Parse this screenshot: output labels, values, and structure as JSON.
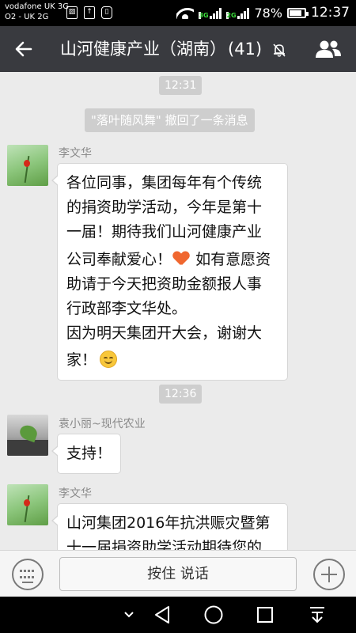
{
  "status_bar": {
    "carrier_line1": "vodafone UK 3G",
    "carrier_line2": "O2 - UK 2G",
    "network1": "3G",
    "network2": "2G",
    "roaming": "R",
    "battery": "78%",
    "time": "12:37",
    "icons": [
      "gallery-icon",
      "sim-icon",
      "vibrate-icon",
      "wifi-icon",
      "signal-icon",
      "battery-icon"
    ]
  },
  "header": {
    "title": "山河健康产业（湖南）",
    "member_count": "(41)",
    "back_icon": "back-arrow-icon",
    "mute_icon": "bell-off-icon",
    "members_icon": "group-members-icon"
  },
  "chat": {
    "timestamp1": "12:31",
    "recall_notice": "\"落叶随风舞\" 撤回了一条消息",
    "msg1": {
      "sender": "李文华",
      "lines": [
        "各位同事，集团每年有个传统",
        "的捐资助学活动，今年是第十",
        "一届！期待我们山河健康产业",
        "公司奉献爱心！",
        "如有意愿资",
        "助请于今天把资助金额报人事",
        "行政部李文华处。",
        "因为明天集团开大会，谢谢大",
        "家！"
      ],
      "emojis": [
        "heart-emoji",
        "smile-emoji"
      ]
    },
    "timestamp2": "12:36",
    "msg2": {
      "sender": "袁小丽~现代农业",
      "text": "支持！"
    },
    "msg3": {
      "sender": "李文华",
      "lines": [
        "山河集团2016年抗洪赈灾暨第",
        "十一届捐资助学活动期待您的"
      ]
    }
  },
  "input_bar": {
    "hold_to_talk": "按住 说话",
    "keyboard_icon": "keyboard-icon",
    "plus_icon": "plus-icon"
  },
  "nav_bar": {
    "icons": [
      "chevron-down-icon",
      "back-triangle-icon",
      "home-circle-icon",
      "recents-square-icon",
      "notification-pulldown-icon"
    ]
  }
}
